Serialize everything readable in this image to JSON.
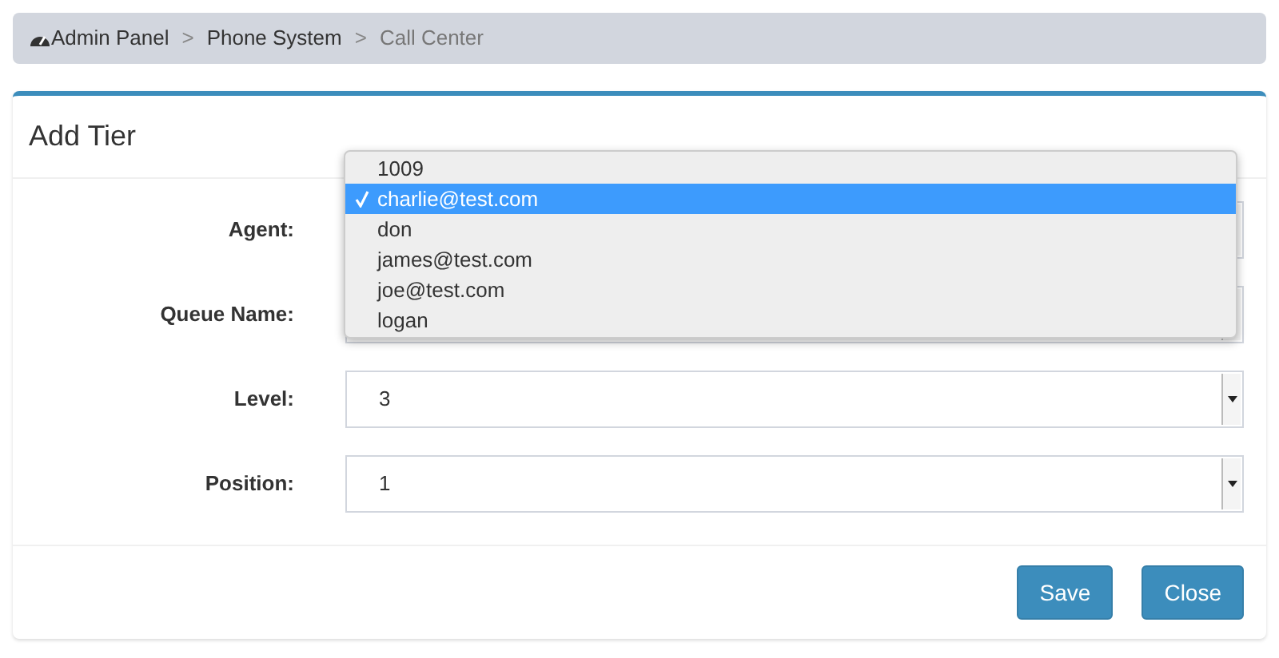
{
  "breadcrumb": [
    {
      "label": "Admin Panel",
      "kind": "home"
    },
    {
      "label": ">",
      "kind": "separator"
    },
    {
      "label": "Phone System",
      "kind": "link"
    },
    {
      "label": ">",
      "kind": "separator"
    },
    {
      "label": "Call Center",
      "kind": "current"
    }
  ],
  "panel": {
    "title": "Add Tier"
  },
  "fields": [
    {
      "label": "Agent:"
    },
    {
      "label": "Queue Name:"
    },
    {
      "label": "Level:",
      "value": "3"
    },
    {
      "label": "Position:",
      "value": "1"
    }
  ],
  "dropdown": {
    "options": [
      {
        "label": "1009",
        "selected": false
      },
      {
        "label": "charlie@test.com",
        "selected": true
      },
      {
        "label": "don",
        "selected": false
      },
      {
        "label": "james@test.com",
        "selected": false
      },
      {
        "label": "joe@test.com",
        "selected": false
      },
      {
        "label": "logan",
        "selected": false
      }
    ]
  },
  "buttons": [
    "Save",
    "Close"
  ]
}
